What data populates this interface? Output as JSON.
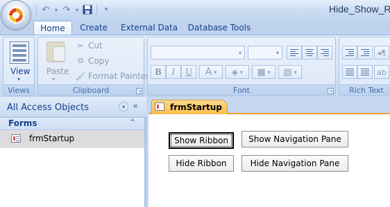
{
  "window": {
    "title": "Hide_Show_R"
  },
  "quick_access": {
    "undo_icon": "undo-icon",
    "redo_icon": "redo-icon",
    "save_icon": "save-icon"
  },
  "ribbon": {
    "tabs": [
      {
        "label": "Home",
        "active": true
      },
      {
        "label": "Create",
        "active": false
      },
      {
        "label": "External Data",
        "active": false
      },
      {
        "label": "Database Tools",
        "active": false
      }
    ],
    "groups": {
      "views": {
        "label": "Views",
        "view_label": "View"
      },
      "clipboard": {
        "label": "Clipboard",
        "paste_label": "Paste",
        "cut_label": "Cut",
        "copy_label": "Copy",
        "format_painter_label": "Format Painter"
      },
      "font": {
        "label": "Font",
        "bold": "B",
        "italic": "I",
        "underline": "U",
        "font_color": "A"
      },
      "rich_text": {
        "label": "Rich Text"
      }
    }
  },
  "nav_pane": {
    "title": "All Access Objects",
    "group_label": "Forms",
    "items": [
      {
        "label": "frmStartup"
      }
    ]
  },
  "document": {
    "tab_label": "frmStartup",
    "buttons": {
      "show_ribbon": "Show Ribbon",
      "show_nav_pane": "Show Navigation Pane",
      "hide_ribbon": "Hide Ribbon",
      "hide_nav_pane": "Hide Navigation Pane"
    }
  },
  "colors": {
    "accent": "#15428b",
    "doc_tab": "#fbbf4d",
    "ribbon_bg": "#dde8f7"
  }
}
